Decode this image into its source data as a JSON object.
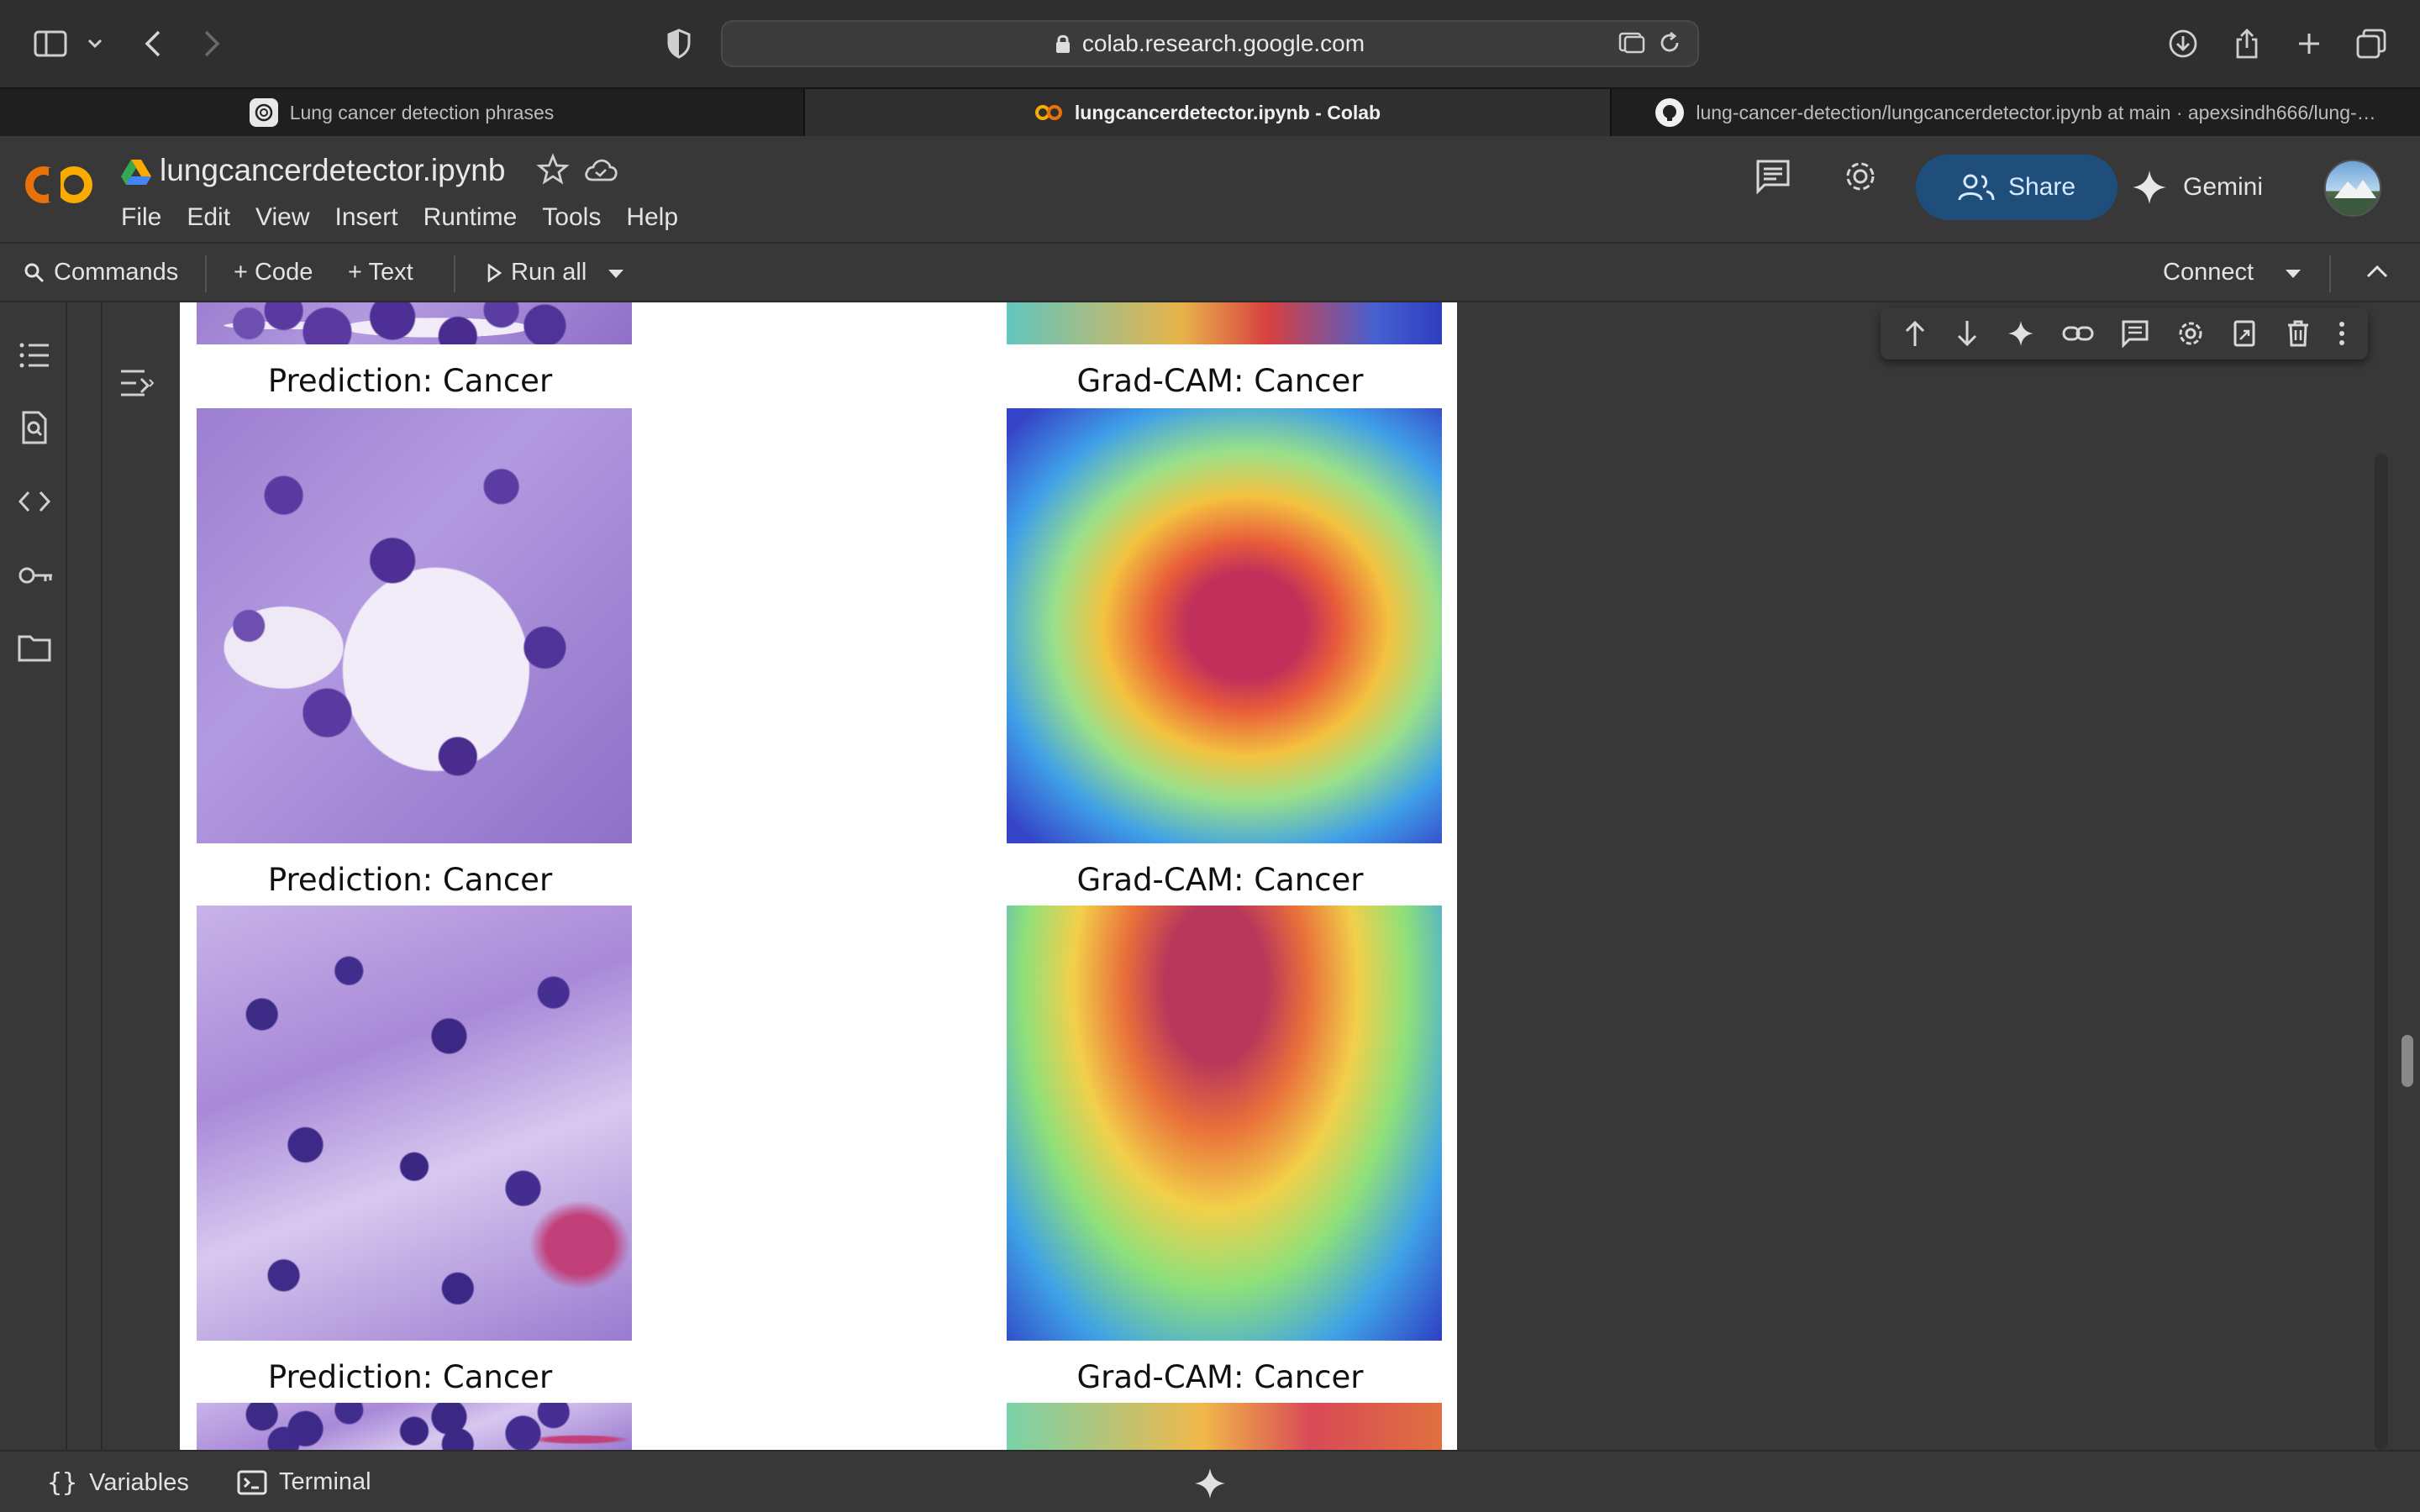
{
  "browser": {
    "url": "colab.research.google.com",
    "tabs": [
      {
        "label": "Lung cancer detection phrases",
        "active": false,
        "icon": "openai-icon"
      },
      {
        "label": "lungcancerdetector.ipynb - Colab",
        "active": true,
        "icon": "colab-icon"
      },
      {
        "label": "lung-cancer-detection/lungcancerdetector.ipynb at main · apexsindh666/lung-…",
        "active": false,
        "icon": "github-icon"
      }
    ]
  },
  "notebook": {
    "title": "lungcancerdetector.ipynb",
    "menu": [
      "File",
      "Edit",
      "View",
      "Insert",
      "Runtime",
      "Tools",
      "Help"
    ],
    "share_label": "Share",
    "gemini_label": "Gemini"
  },
  "toolbar": {
    "commands": "Commands",
    "add_code": "+ Code",
    "add_text": "+ Text",
    "run_all": "Run all",
    "connect": "Connect"
  },
  "output": {
    "rows": [
      {
        "left": "Prediction: Cancer",
        "right": "Grad-CAM: Cancer"
      },
      {
        "left": "Prediction: Cancer",
        "right": "Grad-CAM: Cancer"
      },
      {
        "left": "Prediction: Cancer",
        "right": "Grad-CAM: Cancer"
      }
    ]
  },
  "statusbar": {
    "variables": "Variables",
    "terminal": "Terminal"
  },
  "colors": {
    "share_bg": "#1f4e7a",
    "colab_orange": "#f9ab00",
    "background": "#383838"
  }
}
